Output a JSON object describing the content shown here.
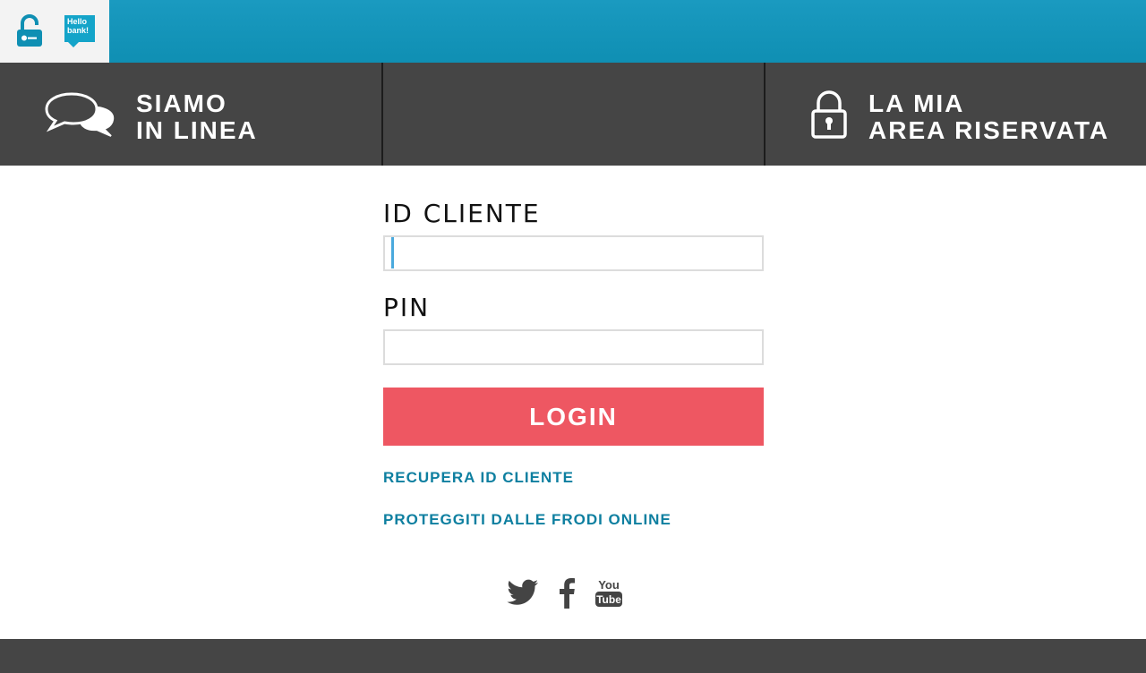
{
  "topbar": {
    "logo_icon": "lock-key-icon",
    "brand_icon": "hello-bank-logo",
    "brand_text_line1": "Hello",
    "brand_text_line2": "bank!",
    "accent_color": "#0f8fb3"
  },
  "nav": {
    "chat": {
      "icon": "chat-bubbles-icon",
      "line1": "SIAMO",
      "line2": "IN LINEA"
    },
    "area": {
      "icon": "padlock-icon",
      "line1": "LA MIA",
      "line2": "AREA RISERVATA"
    }
  },
  "form": {
    "id_label": "ID CLIENTE",
    "id_value": "",
    "pin_label": "PIN",
    "pin_value": "",
    "login_label": "LOGIN",
    "login_color": "#ee5762"
  },
  "links": {
    "recover_id": "RECUPERA ID CLIENTE",
    "fraud": "PROTEGGITI DALLE FRODI ONLINE",
    "link_color": "#0e7fa0"
  },
  "social": {
    "items": [
      "twitter-icon",
      "facebook-icon",
      "youtube-icon"
    ],
    "youtube_text_1": "You",
    "youtube_text_2": "Tube"
  }
}
